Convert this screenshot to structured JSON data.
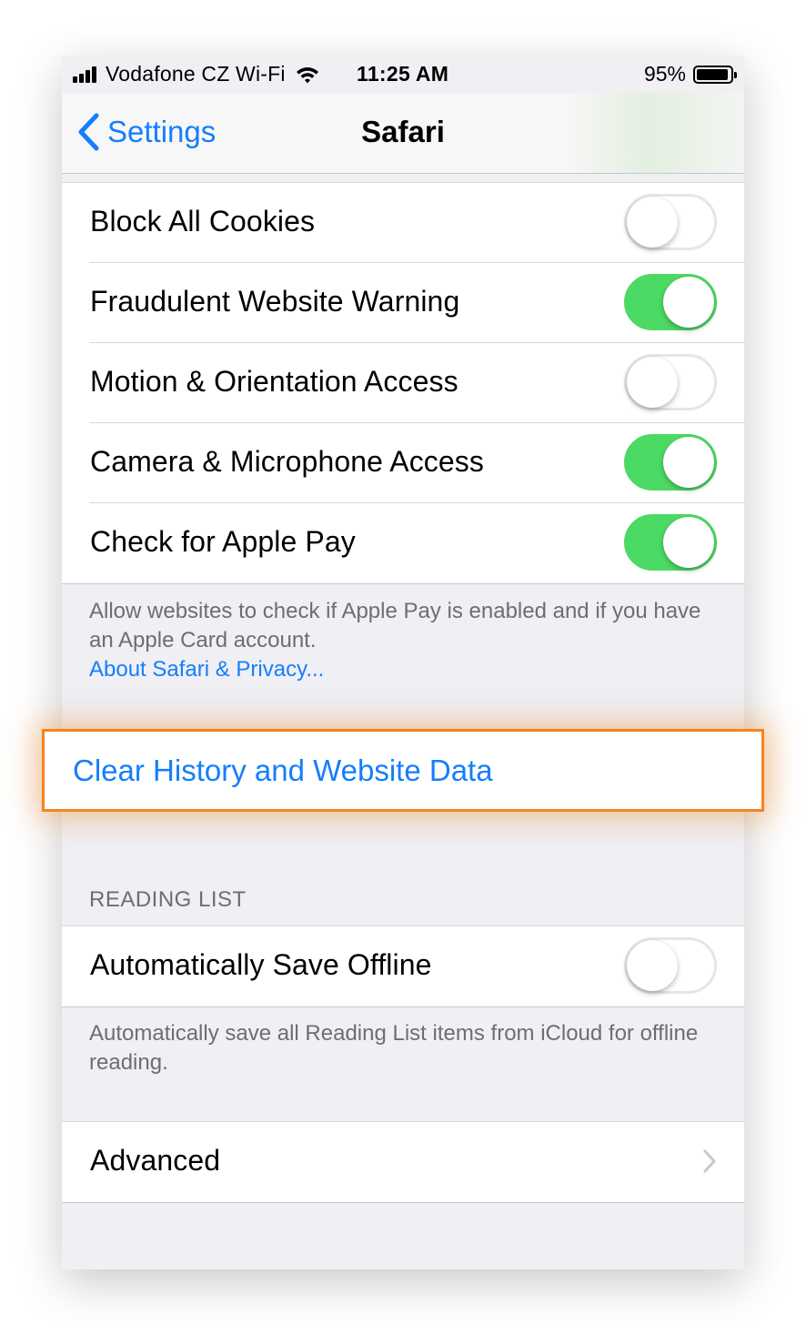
{
  "status_bar": {
    "carrier": "Vodafone CZ Wi-Fi",
    "time": "11:25 AM",
    "battery": "95%",
    "battery_level": 0.95
  },
  "nav": {
    "back_label": "Settings",
    "title": "Safari"
  },
  "privacy_rows": [
    {
      "label": "Block All Cookies",
      "enabled": false
    },
    {
      "label": "Fraudulent Website Warning",
      "enabled": true
    },
    {
      "label": "Motion & Orientation Access",
      "enabled": false
    },
    {
      "label": "Camera & Microphone Access",
      "enabled": true
    },
    {
      "label": "Check for Apple Pay",
      "enabled": true
    }
  ],
  "privacy_footer": {
    "text": "Allow websites to check if Apple Pay is enabled and if you have an Apple Card account.",
    "link": "About Safari & Privacy..."
  },
  "clear_action": {
    "label": "Clear History and Website Data"
  },
  "reading_list": {
    "header": "READING LIST",
    "row_label": "Automatically Save Offline",
    "enabled": false,
    "footer": "Automatically save all Reading List items from iCloud for offline reading."
  },
  "advanced": {
    "label": "Advanced"
  },
  "colors": {
    "accent": "#157efb",
    "toggle_on": "#4cd964",
    "highlight": "#f5841f"
  }
}
